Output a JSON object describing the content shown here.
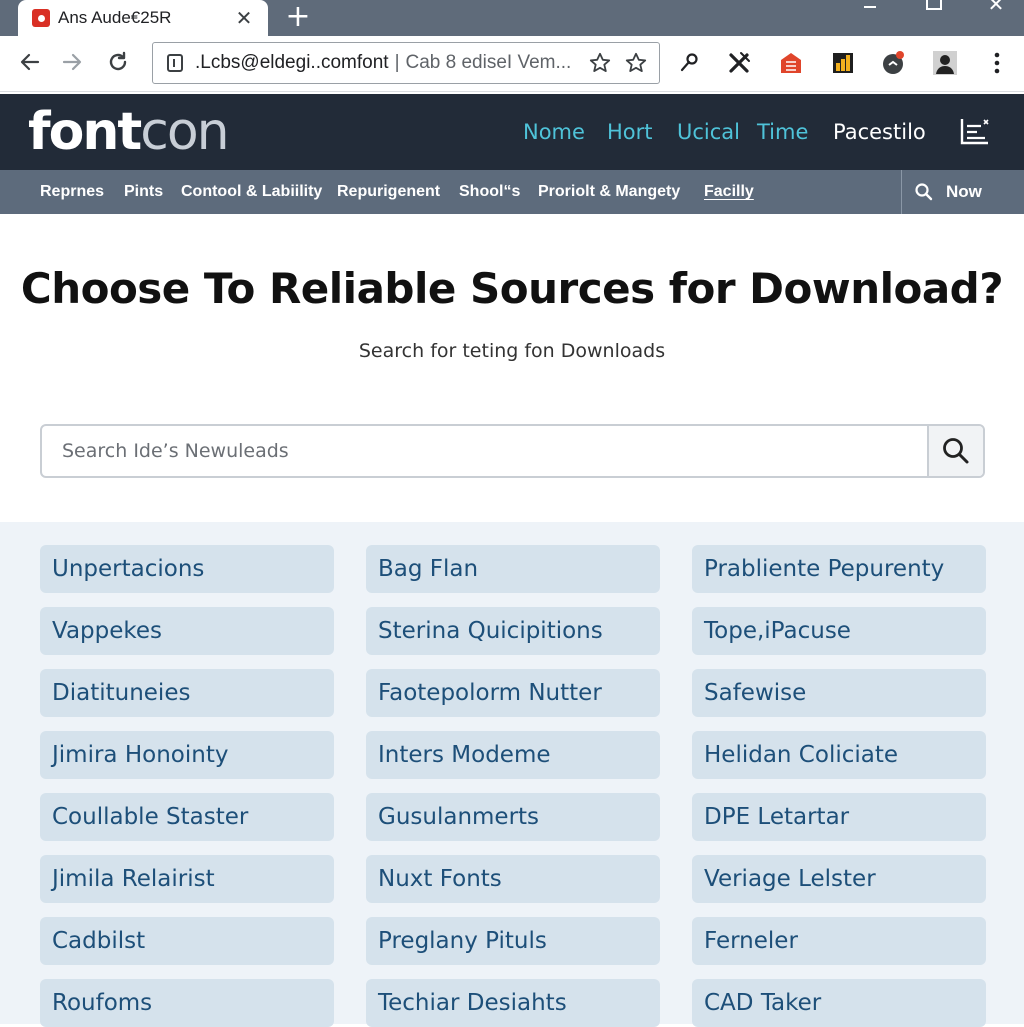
{
  "browser": {
    "tab_title": "Ans Aude€25R",
    "tab_close": "✕",
    "new_tab": "+",
    "win_close": "✕",
    "url": ".Lcbs@eldegi..comfont",
    "url_separator": "|",
    "url_rest": "Cab 8 ediseI Vem..."
  },
  "site": {
    "logo_part1": "font",
    "logo_part2": "con",
    "main_nav": [
      "Nome",
      "Hort",
      "Ucical",
      "Time",
      "Pacestilo"
    ],
    "sub_nav": [
      "Reprnes",
      "Pints",
      "Contool & Labiility",
      "Repurigenent",
      "Shool“s",
      "Proriolt & Mangety",
      "Facilly"
    ],
    "sub_search_label": "Now"
  },
  "hero": {
    "title": "Choose To Reliable Sources for Download?",
    "subtitle": "Search for teting fon Downloads",
    "search_placeholder": "Search Ide’s Newuleads"
  },
  "sources": [
    "Unpertacions",
    "Bag Flan",
    "Prabliente  Pepurenty",
    "Vappekes",
    "Sterina Quicipitions",
    "Tope,iPacuse",
    "Diatituneies",
    "Faotepolorm Nutter",
    "Safewise",
    "Jimira Honointy",
    "Inters Modeme",
    "Helidan Coliciate",
    "Coullable Staster",
    "Gusulanmerts",
    "DPE Letartar",
    "Jimila Relairist",
    "Nuxt Fonts",
    "Veriage Lelster",
    "Cadbilst",
    "Preglany Pituls",
    "Ferneler",
    "Roufoms",
    "Techiar Desiahts",
    "CAD Taker"
  ],
  "colors": {
    "header_bg": "#222b38",
    "subnav_bg": "#5d6b7c",
    "nav_accent": "#4fc3d9",
    "tile_bg": "#d5e2ec",
    "tile_text": "#1d4f79"
  }
}
